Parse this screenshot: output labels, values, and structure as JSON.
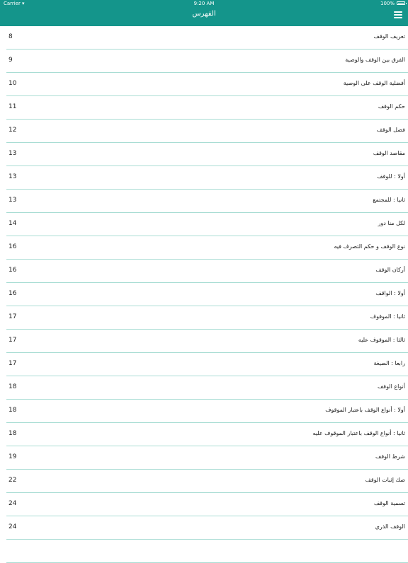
{
  "status_bar": {
    "carrier": "Carrier",
    "time": "9:20 AM",
    "battery": "100%"
  },
  "nav": {
    "title": "الفهرس",
    "menu_icon": "hamburger-menu-icon"
  },
  "colors": {
    "accent": "#14958b",
    "divider": "#a9ddd4"
  },
  "toc": [
    {
      "title": "تعريف الوقف",
      "page": "8"
    },
    {
      "title": "الفرق بين الوقف والوصية",
      "page": "9"
    },
    {
      "title": "أفضلية الوقف على الوصية",
      "page": "10"
    },
    {
      "title": "حكم الوقف",
      "page": "11"
    },
    {
      "title": "فضل الوقف",
      "page": "12"
    },
    {
      "title": "مقاصد الوقف",
      "page": "13"
    },
    {
      "title": "أولا : للوقف",
      "page": "13"
    },
    {
      "title": "ثانيا : للمجتمع",
      "page": "13"
    },
    {
      "title": "لكل منا دور",
      "page": "14"
    },
    {
      "title": "نوع الوقف و حكم التصرف فيه",
      "page": "16"
    },
    {
      "title": "أركان الوقف",
      "page": "16"
    },
    {
      "title": "أولا : الواقف",
      "page": "16"
    },
    {
      "title": "ثانيا : الموقوف",
      "page": "17"
    },
    {
      "title": "ثالثا : الموقوف عليه",
      "page": "17"
    },
    {
      "title": "رابعا : الصيغة",
      "page": "17"
    },
    {
      "title": "أنواع الوقف",
      "page": "18"
    },
    {
      "title": "أولا : أنواع الوقف باعتبار الموقوف",
      "page": "18"
    },
    {
      "title": "ثانيا : أنواع الوقف باعتبار الموقوف عليه",
      "page": "18"
    },
    {
      "title": "شرط الوقف",
      "page": "19"
    },
    {
      "title": "صك إثبات الوقف",
      "page": "22"
    },
    {
      "title": "تسمية الوقف",
      "page": "24"
    },
    {
      "title": "الوقف الذري",
      "page": "24"
    },
    {
      "title": "",
      "page": ""
    }
  ]
}
